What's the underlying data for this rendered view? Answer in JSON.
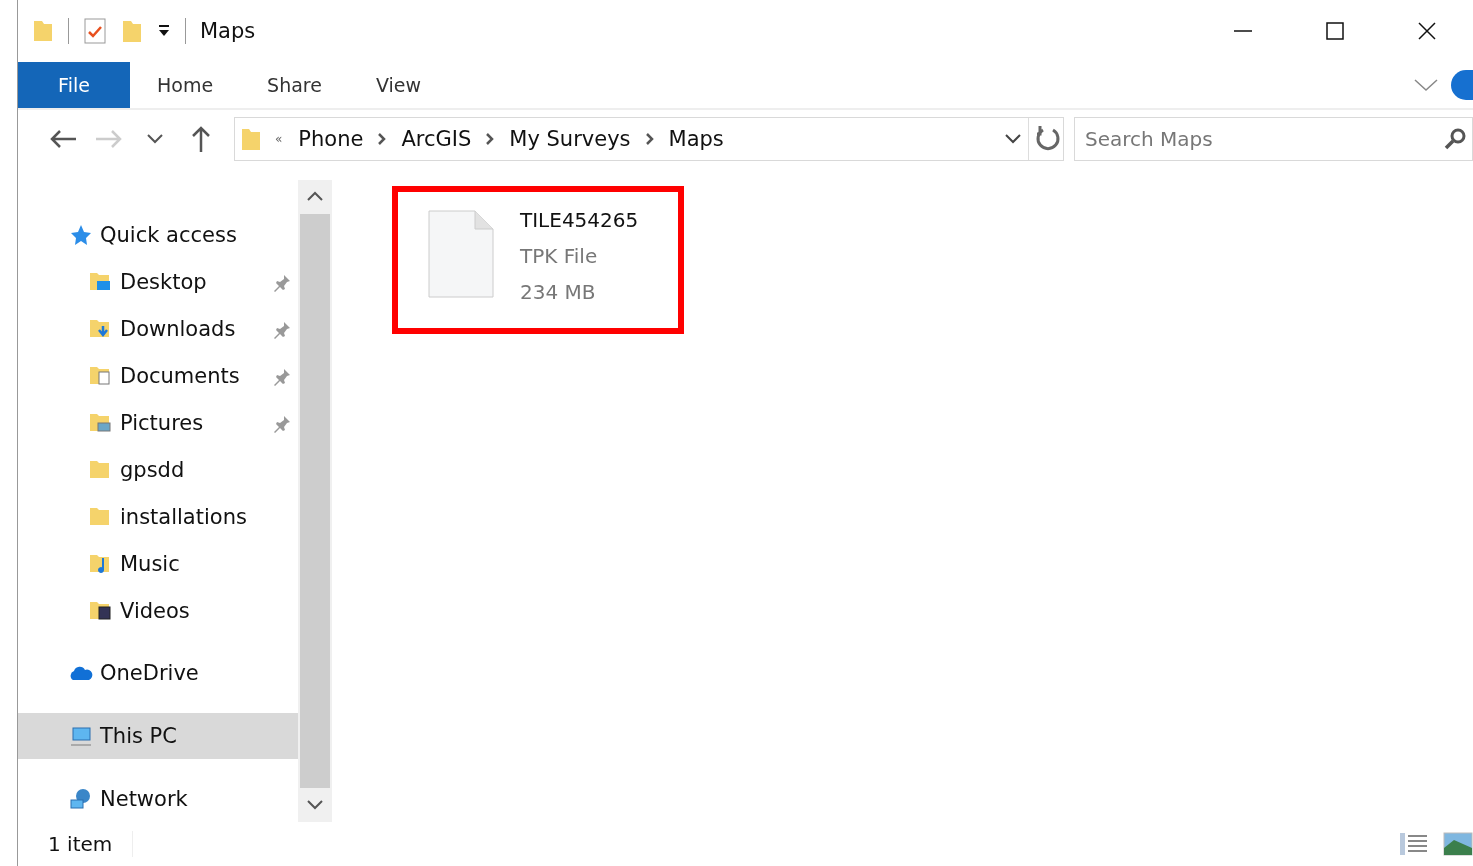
{
  "window": {
    "title": "Maps"
  },
  "ribbon": {
    "tabs": [
      {
        "label": "File",
        "selected": true
      },
      {
        "label": "Home",
        "selected": false
      },
      {
        "label": "Share",
        "selected": false
      },
      {
        "label": "View",
        "selected": false
      }
    ]
  },
  "address": {
    "overflow": "«",
    "crumbs": [
      "Phone",
      "ArcGIS",
      "My Surveys",
      "Maps"
    ]
  },
  "search": {
    "placeholder": "Search Maps"
  },
  "sidebar": {
    "items": [
      {
        "label": "Quick access",
        "kind": "star",
        "selected": false,
        "children": [
          {
            "label": "Desktop",
            "kind": "desktop",
            "pinned": true,
            "selected": false
          },
          {
            "label": "Downloads",
            "kind": "downloads",
            "pinned": true,
            "selected": false
          },
          {
            "label": "Documents",
            "kind": "documents",
            "pinned": true,
            "selected": false
          },
          {
            "label": "Pictures",
            "kind": "pictures",
            "pinned": true,
            "selected": false
          },
          {
            "label": "gpsdd",
            "kind": "folder",
            "pinned": false,
            "selected": false
          },
          {
            "label": "installations",
            "kind": "folder",
            "pinned": false,
            "selected": false
          },
          {
            "label": "Music",
            "kind": "music",
            "pinned": false,
            "selected": false
          },
          {
            "label": "Videos",
            "kind": "videos",
            "pinned": false,
            "selected": false
          }
        ]
      },
      {
        "label": "OneDrive",
        "kind": "cloud",
        "selected": false
      },
      {
        "label": "This PC",
        "kind": "computer",
        "selected": true
      },
      {
        "label": "Network",
        "kind": "network",
        "selected": false
      }
    ]
  },
  "files": [
    {
      "name": "TILE454265",
      "type": "TPK File",
      "size": "234 MB",
      "outlined": true
    }
  ],
  "status_bar": {
    "count": "1 item"
  }
}
